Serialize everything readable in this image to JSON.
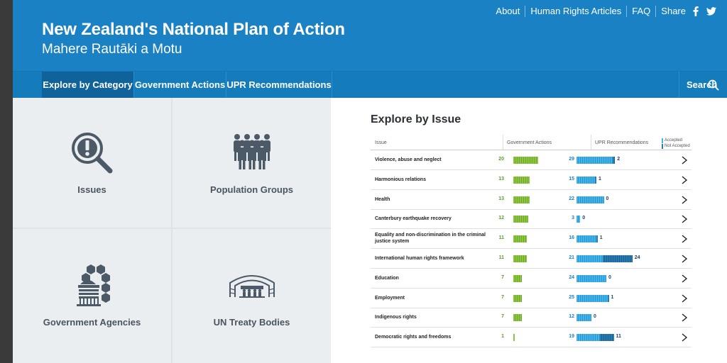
{
  "header": {
    "title": "New Zealand's National Plan of Action",
    "subtitle": "Mahere Rautāki a Motu",
    "links": [
      "About",
      "Human Rights Articles",
      "FAQ",
      "Share"
    ]
  },
  "nav": {
    "items": [
      "Explore by Category",
      "Government Actions",
      "UPR Recommendations"
    ],
    "active": "Explore by Category",
    "search_label": "Search"
  },
  "categories": [
    {
      "label": "Issues",
      "icon": "alert-magnifier-icon"
    },
    {
      "label": "Population Groups",
      "icon": "people-group-icon"
    },
    {
      "label": "Government Agencies",
      "icon": "beehive-building-icon"
    },
    {
      "label": "UN Treaty Bodies",
      "icon": "assembly-chamber-icon"
    }
  ],
  "issues_panel": {
    "title": "Explore by Issue",
    "col_issue": "Issue",
    "col_gov": "Government Actions",
    "col_upr": "UPR Recommendations",
    "legend_accepted": "Accepted",
    "legend_not_accepted": "Not Accepted",
    "colors": {
      "gov": "#8cc63f",
      "accepted": "#43b3ea",
      "not_accepted": "#2a7bb0"
    },
    "rows": [
      {
        "name": "Violence, abuse and neglect",
        "gov": "20",
        "accepted": "29",
        "not_accepted": "2"
      },
      {
        "name": "Harmonious relations",
        "gov": "13",
        "accepted": "15",
        "not_accepted": "1"
      },
      {
        "name": "Health",
        "gov": "13",
        "accepted": "22",
        "not_accepted": "0"
      },
      {
        "name": "Canterbury earthquake recovery",
        "gov": "12",
        "accepted": "3",
        "not_accepted": "0"
      },
      {
        "name": "Equality and non-discrimination in the criminal justice system",
        "gov": "11",
        "accepted": "16",
        "not_accepted": "1"
      },
      {
        "name": "International human rights framework",
        "gov": "11",
        "accepted": "21",
        "not_accepted": "24"
      },
      {
        "name": "Education",
        "gov": "7",
        "accepted": "24",
        "not_accepted": "0"
      },
      {
        "name": "Employment",
        "gov": "7",
        "accepted": "25",
        "not_accepted": "1"
      },
      {
        "name": "Indigenous rights",
        "gov": "7",
        "accepted": "12",
        "not_accepted": "0"
      },
      {
        "name": "Democratic rights and freedoms",
        "gov": "1",
        "accepted": "19",
        "not_accepted": "11"
      }
    ]
  }
}
